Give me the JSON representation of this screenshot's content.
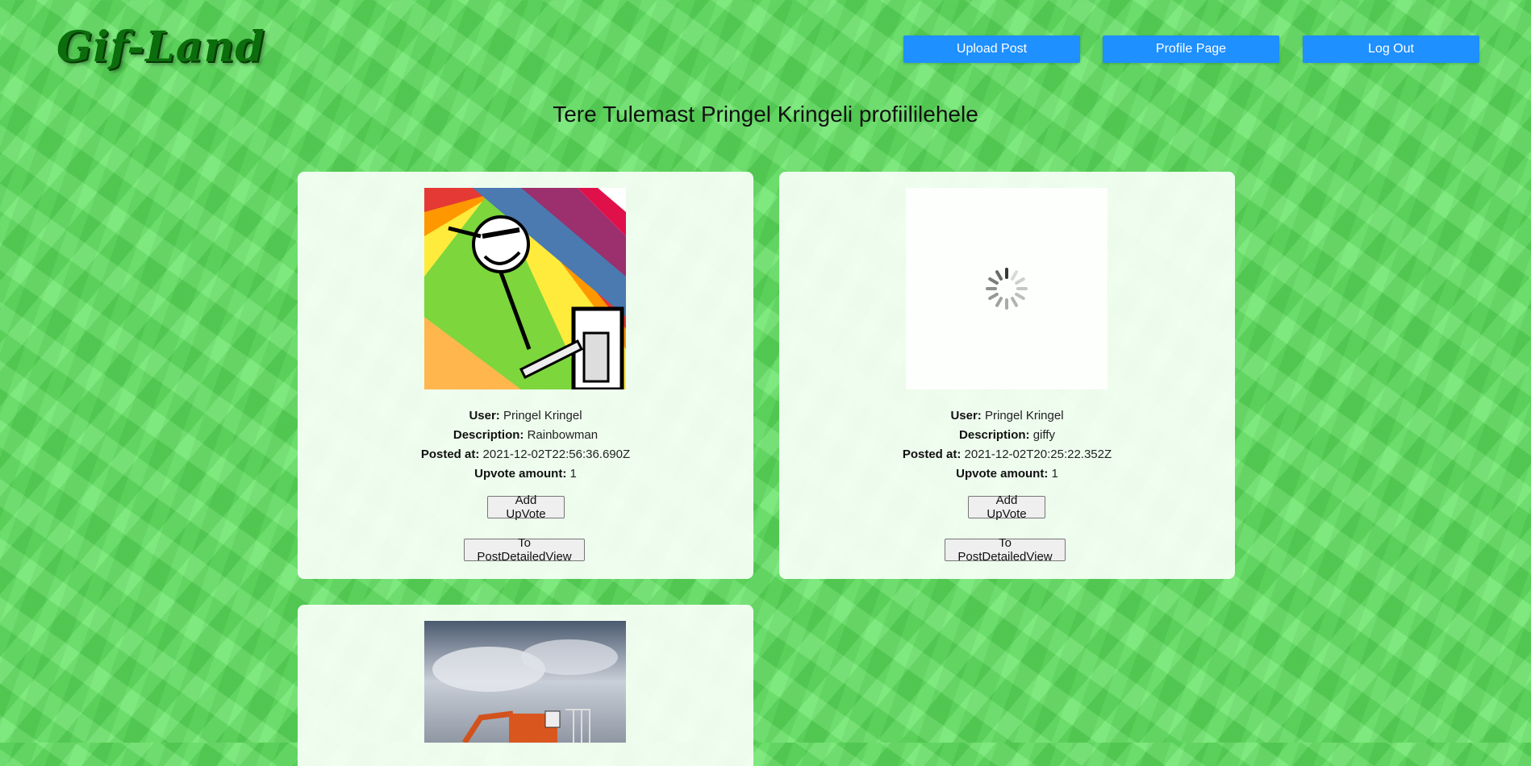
{
  "app": {
    "logo": "Gif-Land"
  },
  "nav": {
    "upload_label": "Upload Post",
    "profile_label": "Profile Page",
    "logout_label": "Log Out",
    "button_color": "#1e90ff"
  },
  "page": {
    "title": "Tere Tulemast Pringel Kringeli profiililehele"
  },
  "labels": {
    "user": "User:",
    "description": "Description:",
    "posted_at": "Posted at:",
    "upvotes": "Upvote amount:",
    "add_upvote": "Add UpVote",
    "detail_view": "To PostDetailedView"
  },
  "posts": [
    {
      "user": "Pringel Kringel",
      "description": "Rainbowman",
      "posted_at": "2021-12-02T22:56:36.690Z",
      "upvotes": "1",
      "image": "rainbowman-gif"
    },
    {
      "user": "Pringel Kringel",
      "description": "giffy",
      "posted_at": "2021-12-02T20:25:22.352Z",
      "upvotes": "1",
      "image": "loading-spinner-gif"
    },
    {
      "image": "excavator-gif"
    }
  ]
}
